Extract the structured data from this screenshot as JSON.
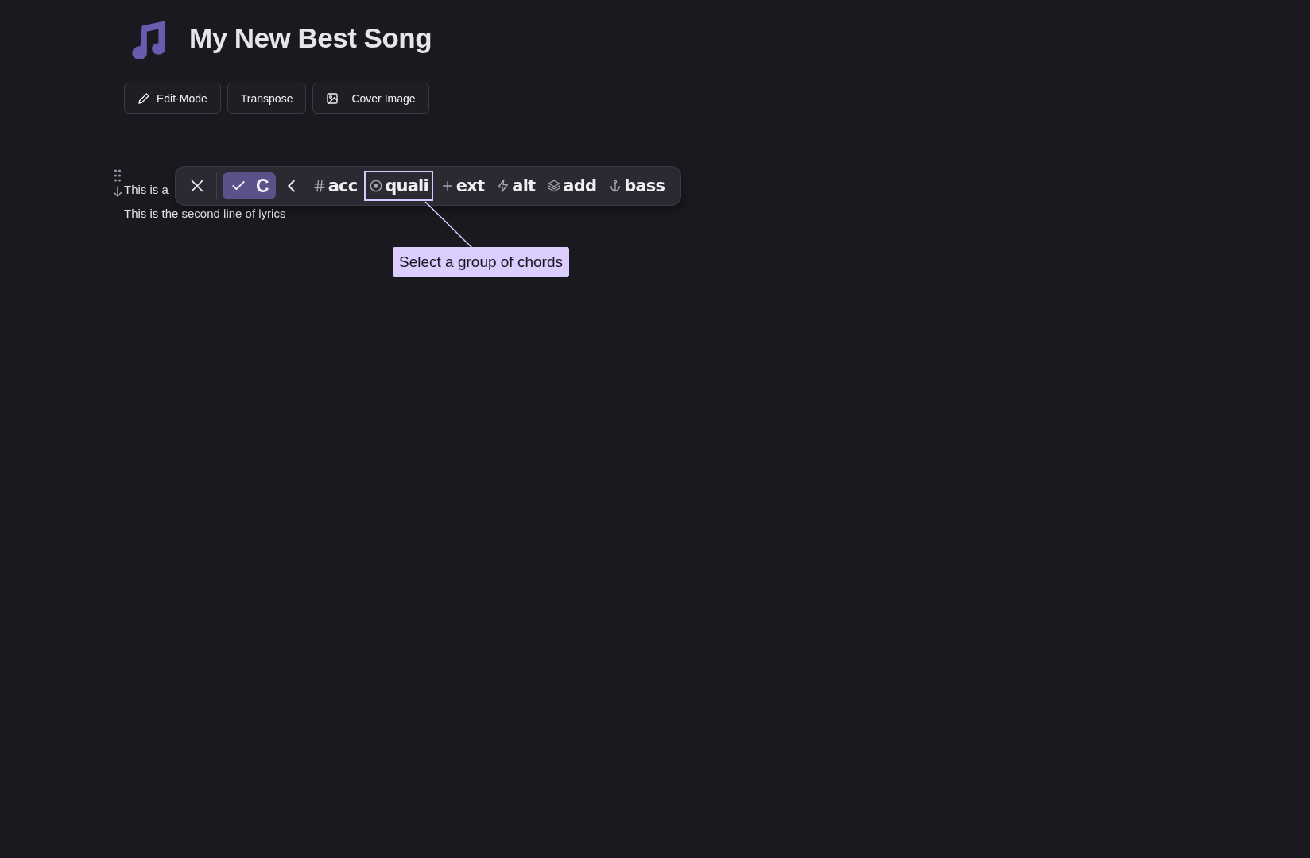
{
  "song": {
    "title": "My New Best Song"
  },
  "actions": [
    {
      "kind": "edit",
      "label": "Edit-Mode"
    },
    {
      "kind": "plain",
      "label": "Transpose"
    },
    {
      "kind": "image",
      "label": "Cover Image"
    }
  ],
  "lyrics": [
    {
      "text": "This is a",
      "handle": true
    },
    {
      "text": "This is the second line of lyrics",
      "handle": false
    }
  ],
  "chord_toolbar": {
    "items": [
      {
        "kind": "close"
      },
      {
        "kind": "chord",
        "label": "C",
        "selected": true
      },
      {
        "kind": "back"
      },
      {
        "kind": "group",
        "label": "acc",
        "highlighted": false
      },
      {
        "kind": "group",
        "label": "quali",
        "highlighted": true
      },
      {
        "kind": "group",
        "label": "ext",
        "highlighted": false
      },
      {
        "kind": "group",
        "label": "alt",
        "highlighted": false
      },
      {
        "kind": "group",
        "label": "add",
        "highlighted": false
      },
      {
        "kind": "group",
        "label": "bass",
        "highlighted": false
      }
    ]
  },
  "tooltip": {
    "text": "Select a group of chords"
  }
}
